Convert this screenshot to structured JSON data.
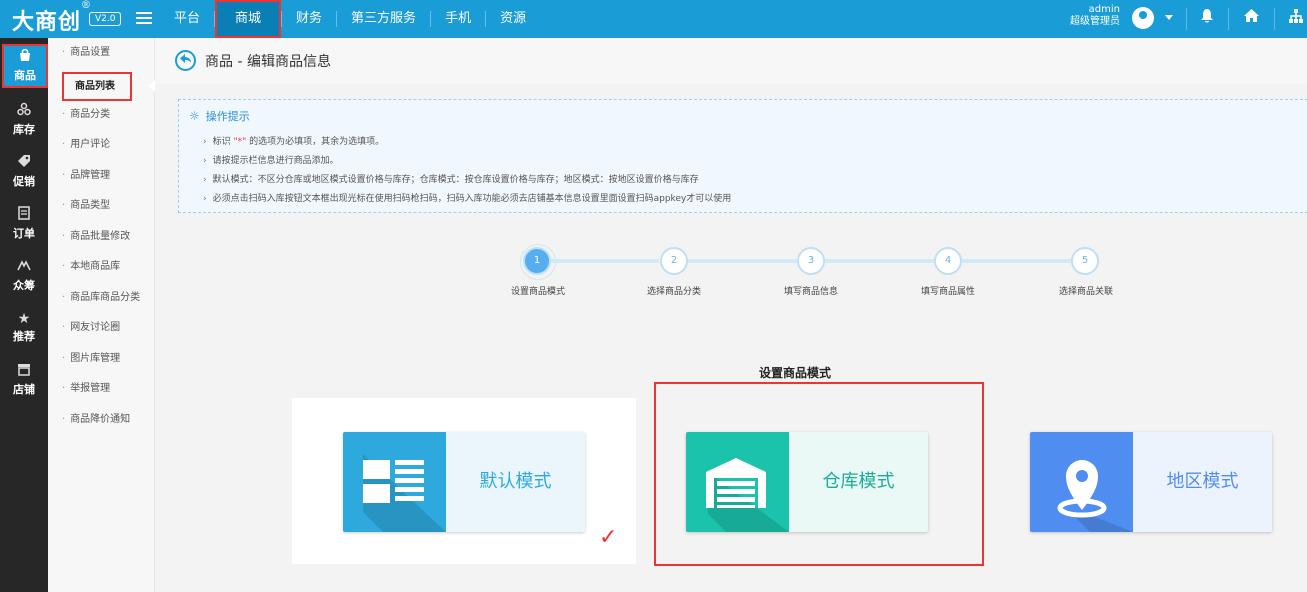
{
  "brand": {
    "logo": "大商创",
    "registered": "®",
    "version": "V2.0"
  },
  "topnav": [
    {
      "label": "平台"
    },
    {
      "label": "商城"
    },
    {
      "label": "财务"
    },
    {
      "label": "第三方服务"
    },
    {
      "label": "手机"
    },
    {
      "label": "资源"
    }
  ],
  "user": {
    "name": "admin",
    "role": "超级管理员"
  },
  "left_sidebar": [
    {
      "label": "商品",
      "icon": "bag-icon"
    },
    {
      "label": "库存",
      "icon": "stock-icon"
    },
    {
      "label": "促销",
      "icon": "tag-icon"
    },
    {
      "label": "订单",
      "icon": "order-icon"
    },
    {
      "label": "众筹",
      "icon": "crowdfund-icon"
    },
    {
      "label": "推荐",
      "icon": "star-icon"
    },
    {
      "label": "店铺",
      "icon": "store-icon"
    }
  ],
  "submenu": [
    {
      "label": "商品设置"
    },
    {
      "label": "商品列表"
    },
    {
      "label": "商品分类"
    },
    {
      "label": "用户评论"
    },
    {
      "label": "品牌管理"
    },
    {
      "label": "商品类型"
    },
    {
      "label": "商品批量修改"
    },
    {
      "label": "本地商品库"
    },
    {
      "label": "商品库商品分类"
    },
    {
      "label": "网友讨论圈"
    },
    {
      "label": "图片库管理"
    },
    {
      "label": "举报管理"
    },
    {
      "label": "商品降价通知"
    }
  ],
  "page": {
    "title": "商品 - 编辑商品信息"
  },
  "tips": {
    "title": "操作提示",
    "line1_pre": "标识",
    "line1_mark": "\"*\"",
    "line1_post": "的选项为必填项，其余为选填项。",
    "line2": "请按提示栏信息进行商品添加。",
    "line3": "默认模式：不区分仓库或地区模式设置价格与库存；仓库模式：按仓库设置价格与库存；地区模式：按地区设置价格与库存",
    "line4": "必须点击扫码入库按钮文本框出现光标在使用扫码枪扫码，扫码入库功能必须去店铺基本信息设置里面设置扫码appkey才可以使用"
  },
  "steps": [
    {
      "num": "1",
      "label": "设置商品模式"
    },
    {
      "num": "2",
      "label": "选择商品分类"
    },
    {
      "num": "3",
      "label": "填写商品信息"
    },
    {
      "num": "4",
      "label": "填写商品属性"
    },
    {
      "num": "5",
      "label": "选择商品关联"
    }
  ],
  "current_step": 1,
  "mode_section": {
    "title": "设置商品模式"
  },
  "modes": [
    {
      "label": "默认模式",
      "icon": "list-layout-icon",
      "color": "#2ea9dd",
      "selected": true
    },
    {
      "label": "仓库模式",
      "icon": "warehouse-icon",
      "color": "#1bc2ac",
      "selected": false
    },
    {
      "label": "地区模式",
      "icon": "location-pin-icon",
      "color": "#4f8ef0",
      "selected": false
    }
  ],
  "colors": {
    "topbar": "#1a9cd6",
    "sidebar": "#272727",
    "highlight": "#e33333",
    "accent": "#2a8fd0"
  }
}
